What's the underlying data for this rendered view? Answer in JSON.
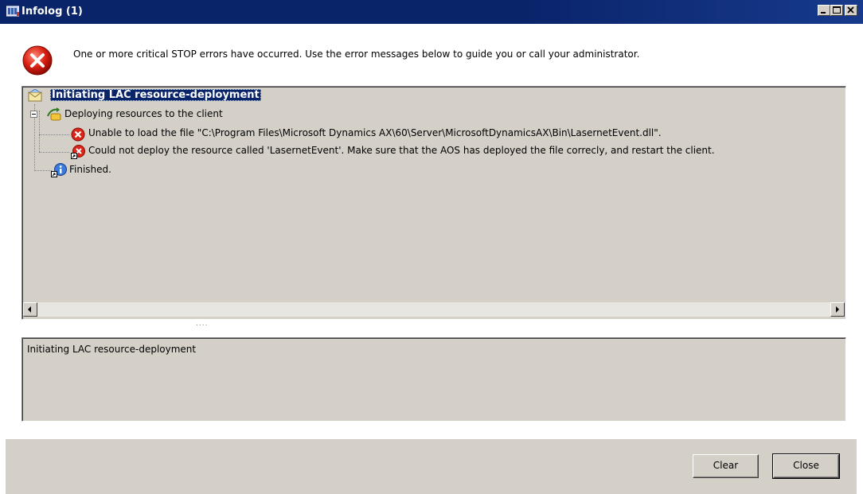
{
  "window": {
    "title": "Infolog (1)",
    "title_bar_color": "#0a246a"
  },
  "header": {
    "icon": "stop-error-icon",
    "message": "One or more critical STOP errors have occurred. Use the error messages below to guide you or call your administrator."
  },
  "tree": {
    "root": {
      "icon": "envelope-icon",
      "label": "Initiating LAC resource-deployment"
    },
    "group": {
      "icon": "deploy-icon",
      "label": "Deploying resources to the client",
      "expanded": true,
      "items": [
        {
          "icon": "error-icon",
          "label": "Unable to load the file \"C:\\Program Files\\Microsoft Dynamics AX\\60\\Server\\MicrosoftDynamicsAX\\Bin\\LasernetEvent.dll\"."
        },
        {
          "icon": "error-shortcut-icon",
          "label": "Could not deploy the resource called 'LasernetEvent'. Make sure that the AOS has deployed the file correcly, and restart the client."
        }
      ]
    },
    "finished": {
      "icon": "info-shortcut-icon",
      "label": "Finished."
    }
  },
  "splitter_grip": "....",
  "detail": {
    "text": "Initiating LAC resource-deployment"
  },
  "buttons": {
    "clear": "Clear",
    "close": "Close"
  }
}
